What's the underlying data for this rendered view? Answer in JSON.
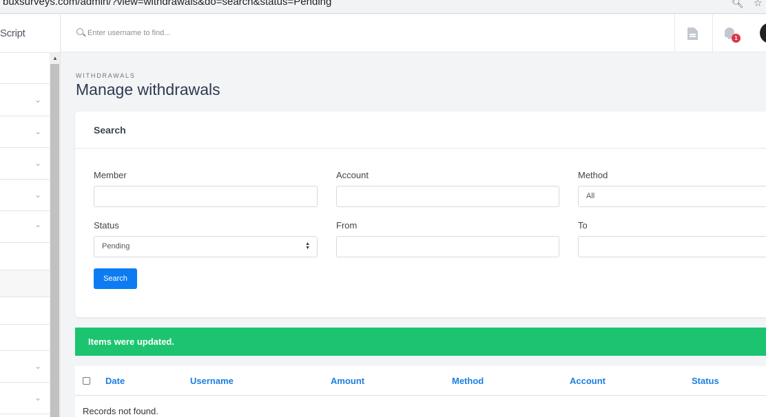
{
  "browser": {
    "url": "buxsurveys.com/admin/?view=withdrawals&do=search&status=Pending",
    "icons": [
      "zoom-icon",
      "star-icon"
    ]
  },
  "sidebar": {
    "brand": "Script",
    "items": [
      {
        "chevron": "down"
      },
      {
        "chevron": "down"
      },
      {
        "chevron": "down"
      },
      {
        "chevron": "down"
      },
      {
        "chevron": "up"
      },
      {
        "chevron": ""
      },
      {
        "chevron": ""
      },
      {
        "chevron": ""
      },
      {
        "chevron": ""
      },
      {
        "chevron": "down"
      },
      {
        "chevron": "down"
      }
    ]
  },
  "topbar": {
    "search_placeholder": "Enter username to find...",
    "notification_count": "1"
  },
  "page": {
    "breadcrumb": "WITHDRAWALS",
    "title": "Manage withdrawals"
  },
  "search_card": {
    "title": "Search",
    "fields": {
      "member": {
        "label": "Member",
        "value": ""
      },
      "account": {
        "label": "Account",
        "value": ""
      },
      "method": {
        "label": "Method",
        "value": "All"
      },
      "status": {
        "label": "Status",
        "value": "Pending"
      },
      "from": {
        "label": "From",
        "value": ""
      },
      "to": {
        "label": "To",
        "value": ""
      }
    },
    "button": "Search"
  },
  "alert": {
    "message": "Items were updated.",
    "color": "#1cc46f"
  },
  "table": {
    "columns": [
      "Date",
      "Username",
      "Amount",
      "Method",
      "Account",
      "Status"
    ],
    "empty_message": "Records not found."
  },
  "colors": {
    "primary": "#0d7cf2",
    "link": "#1a7fe0",
    "badge": "#dc3545"
  }
}
